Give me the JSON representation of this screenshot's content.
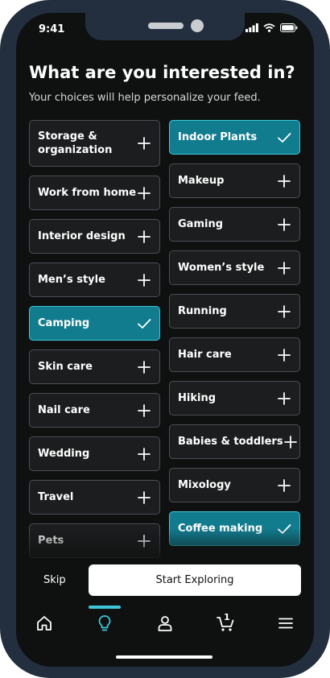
{
  "status": {
    "time": "9:41"
  },
  "header": {
    "title": "What are you interested in?",
    "subtitle": "Your choices will help personalize your feed."
  },
  "interests_left": [
    {
      "label": "Storage &\norganization",
      "selected": false
    },
    {
      "label": "Work from home",
      "selected": false
    },
    {
      "label": "Interior design",
      "selected": false
    },
    {
      "label": "Men’s style",
      "selected": false
    },
    {
      "label": "Camping",
      "selected": true
    },
    {
      "label": "Skin care",
      "selected": false
    },
    {
      "label": "Nail care",
      "selected": false
    },
    {
      "label": "Wedding",
      "selected": false
    },
    {
      "label": "Travel",
      "selected": false
    },
    {
      "label": "Pets",
      "selected": false
    }
  ],
  "interests_right": [
    {
      "label": "Indoor Plants",
      "selected": true
    },
    {
      "label": "Makeup",
      "selected": false
    },
    {
      "label": "Gaming",
      "selected": false
    },
    {
      "label": "Women’s style",
      "selected": false
    },
    {
      "label": "Running",
      "selected": false
    },
    {
      "label": "Hair care",
      "selected": false
    },
    {
      "label": "Hiking",
      "selected": false
    },
    {
      "label": "Babies & toddlers",
      "selected": false
    },
    {
      "label": "Mixology",
      "selected": false
    },
    {
      "label": "Coffee making",
      "selected": true
    }
  ],
  "footer": {
    "skip_label": "Skip",
    "start_label": "Start Exploring"
  },
  "tabbar": {
    "active": "inspire",
    "cart_count": "1",
    "icons": [
      "home-icon",
      "lightbulb-icon",
      "person-icon",
      "cart-icon",
      "menu-icon"
    ]
  },
  "colors": {
    "accent": "#127c8f",
    "accent_border": "#3ec6d8",
    "background": "#0f1111",
    "frame": "#232f3e"
  }
}
